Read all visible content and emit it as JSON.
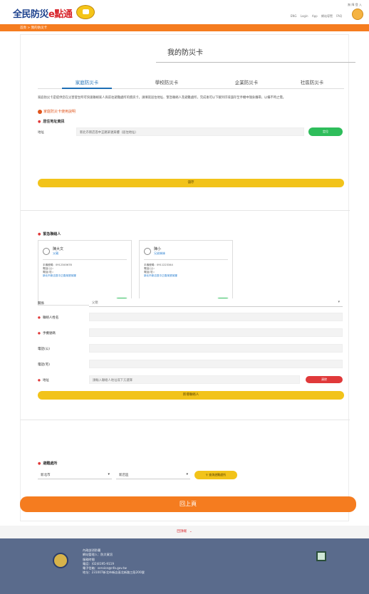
{
  "header": {
    "logo_main": "全民防災",
    "logo_accent": "e點通",
    "top_icons": "無 障 登 入",
    "links": [
      "ENG",
      "Login",
      "App",
      "網站導覽",
      "FAQ"
    ]
  },
  "breadcrumb": "首頁 > 我的防災卡",
  "page": {
    "title": "我的防災卡",
    "tabs": [
      "家庭防災卡",
      "學校防災卡",
      "企業防災卡",
      "社區防災卡"
    ],
    "active_tab": "家庭防災卡",
    "description": "家庭防災卡是提供您在災害發生時可快速聯絡家人與前往避難處所的資訊卡，請填寫居住地址、緊急聯絡人及避難處所，完成後可以下載列印或儲存至手機中隨身攜帶，以備不時之需。",
    "qa_link": "家庭防災卡使用說明"
  },
  "address": {
    "section_title": "居住地址資訊",
    "label": "地址",
    "value": "新北市新店區中正路某號某樓（居住地址）",
    "locate_button": "定位",
    "save_button": "儲存"
  },
  "contacts": {
    "section_title": "緊急聯絡人",
    "people": [
      {
        "name": "陳大文",
        "relation": "父親",
        "lines": [
          "手機號碼：0912345678",
          "電話(公)：",
          "電話(宅)：",
          "新北市新店區中正路某號某樓"
        ],
        "edit": "編輯"
      },
      {
        "name": "陳小",
        "relation": "兄弟姊妹",
        "lines": [
          "手機號碼：0911223344",
          "電話(公)：",
          "電話(宅)：",
          "新北市新店區中正路某號某樓"
        ],
        "edit": "編輯"
      }
    ]
  },
  "form": {
    "relation_label": "關係",
    "relation_value": "父親",
    "name_label": "聯絡人姓名",
    "mobile_label": "手機號碼",
    "tel_office_label": "電話(公)",
    "tel_home_label": "電話(宅)",
    "address_label": "地址",
    "address_placeholder": "請輸入聯絡人地址或下方選擇",
    "clear_button": "清除",
    "add_button": "新增聯絡人"
  },
  "shelter": {
    "section_title": "避難處所",
    "county": "新北市",
    "district": "新店區",
    "search_button": "查詢避難處所"
  },
  "back_button": "回上頁",
  "pager": "回頂端",
  "footer": {
    "org": "內政部消防署",
    "lines": [
      "網站管理人：防災資訊",
      "服務時間",
      "電話：(02)8195-9119",
      "電子信箱：service@nfa.gov.tw",
      "地址：231007新北市新店區北新路三段200號"
    ]
  },
  "colors": {
    "orange": "#f57c1f",
    "green": "#2ebd5b",
    "yellow": "#f2c31a",
    "red": "#e0393a",
    "blue": "#1e6fb5",
    "footer_bg": "#5a6b8c"
  }
}
